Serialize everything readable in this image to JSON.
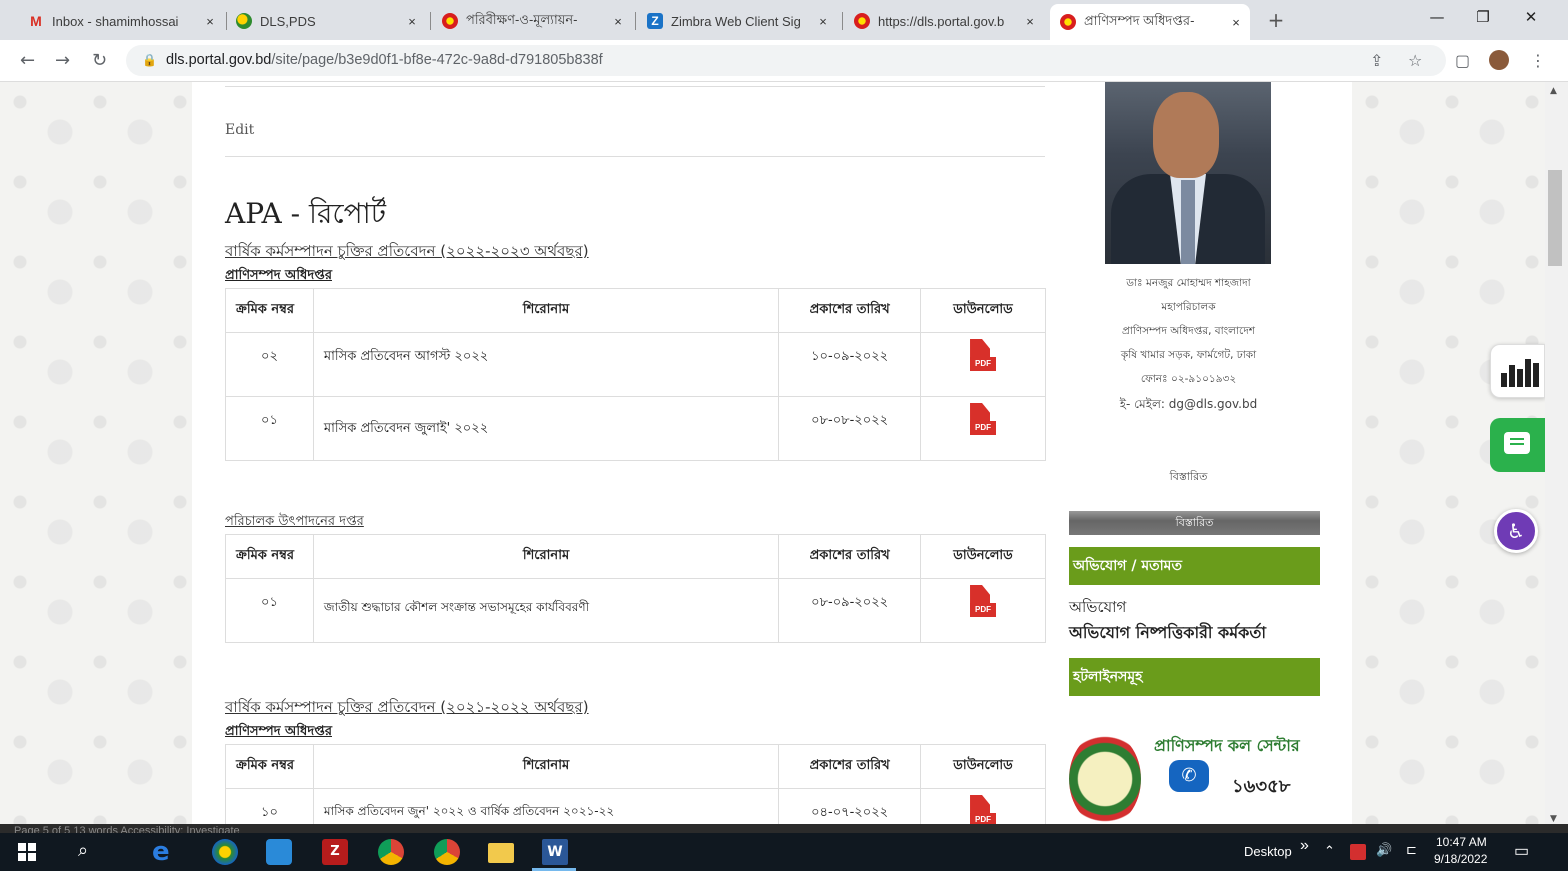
{
  "browser": {
    "tabs": [
      {
        "title": "Inbox - shamimhossai",
        "icon": "gmail-icon"
      },
      {
        "title": "DLS,PDS",
        "icon": "dls-pds-icon"
      },
      {
        "title": "পরিবীক্ষণ-ও-মূল্যায়ন-",
        "icon": "dls-site-icon"
      },
      {
        "title": "Zimbra Web Client Sig",
        "icon": "zimbra-icon"
      },
      {
        "title": "https://dls.portal.gov.b",
        "icon": "dls-site-icon"
      },
      {
        "title": "প্রাণিসম্পদ অধিদপ্তর-",
        "icon": "dls-site-icon",
        "active": true
      }
    ],
    "close_glyph": "×",
    "window_controls": {
      "minimize": "—",
      "maximize": "❐",
      "close": "✕"
    },
    "url_host": "dls.portal.gov.bd",
    "url_path": "/site/page/b3e9d0f1-bf8e-472c-9a8d-d791805b838f"
  },
  "page": {
    "edit_label": "Edit",
    "title": "APA - রিপোর্ট",
    "table_headers": {
      "serial": "ক্রমিক নম্বর",
      "title": "শিরোনাম",
      "date": "প্রকাশের তারিখ",
      "download": "ডাউনলোড"
    },
    "pdf_label": "PDF",
    "sections": [
      {
        "heading": "বার্ষিক কর্মসম্পাদন চুক্তির প্রতিবেদন  (২০২২-২০২৩ অর্থবছর)",
        "subheading": "প্রাণিসম্পদ অধিদপ্তর",
        "rows": [
          {
            "serial": "০২",
            "title": "মাসিক প্রতিবেদন আগস্ট ২০২২",
            "date": "১০-০৯-২০২২"
          },
          {
            "serial": "০১",
            "title": "মাসিক প্রতিবেদন জুলাই' ২০২২",
            "date": "০৮-০৮-২০২২"
          }
        ]
      },
      {
        "heading": "পরিচালক উৎপাদনের দপ্তর",
        "subheading": "",
        "rows": [
          {
            "serial": "০১",
            "title": "জাতীয় শুদ্ধাচার কৌশল সংক্রান্ত সভাসমূহের কার্যবিবরণী",
            "date": "০৮-০৯-২০২২"
          }
        ]
      },
      {
        "heading": "বার্ষিক কর্মসম্পাদন চুক্তির প্রতিবেদন  (২০২১-২০২২ অর্থবছর)",
        "subheading": "প্রাণিসম্পদ অধিদপ্তর",
        "rows": [
          {
            "serial": "১০",
            "title": "মাসিক প্রতিবেদন জুন' ২০২২ ও বার্ষিক প্রতিবেদন ২০২১-২২",
            "date": "০৪-০৭-২০২২"
          }
        ]
      }
    ]
  },
  "sidebar": {
    "dg_name": "ডাঃ মনজুর মোহাম্মদ শাহজাদা",
    "dg_designation": "মহাপরিচালক",
    "dg_office": "প্রাণিসম্পদ অধিদপ্তর, বাংলাদেশ",
    "dg_address": "কৃষি খামার সড়ক, ফার্মগেট, ঢাকা",
    "dg_phone": "ফোনঃ ০২-৯১০১৯৩২",
    "dg_email": "ই- মেইল: dg@dls.gov.bd",
    "details_link": "বিস্তারিত",
    "details_bar": "বিস্তারিত",
    "complaint_heading": "অভিযোগ / মতামত",
    "complaint_link": "অভিযোগ",
    "complaint_officer_link": "অভিযোগ নিষ্পত্তিকারী কর্মকর্তা",
    "hotline_heading": "হটলাইনসমূহ",
    "call_center": "প্রাণিসম্পদ  কল সেন্টার",
    "hotline_number": "১৬৩৫৮"
  },
  "word_status": "Page 5 of 5     13 words     Accessibility: Investigate",
  "taskbar": {
    "desktop_label": "Desktop",
    "chevron": "»",
    "time": "10:47 AM",
    "date": "9/18/2022"
  },
  "colors": {
    "green_heading": "#6a9c1b",
    "pdf_red": "#d8302a",
    "chat_green": "#2bb14c",
    "accessibility_purple": "#6f3bb5"
  }
}
